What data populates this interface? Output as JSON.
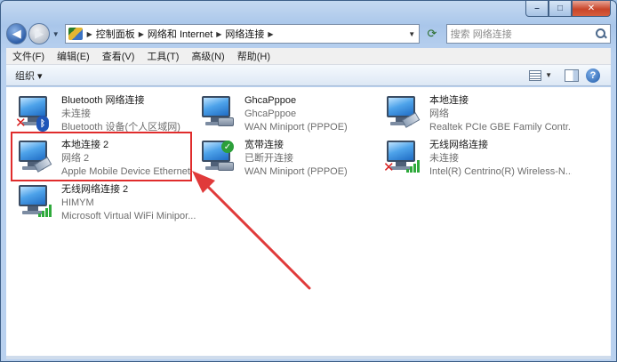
{
  "window": {
    "buttons": {
      "minimize": "–",
      "maximize": "□",
      "close": "✕"
    }
  },
  "nav": {
    "back_icon": "arrow-left-icon",
    "forward_icon": "arrow-right-icon",
    "breadcrumb": [
      "控制面板",
      "网络和 Internet",
      "网络连接"
    ],
    "search_placeholder": "搜索 网络连接"
  },
  "menu": [
    "文件(F)",
    "编辑(E)",
    "查看(V)",
    "工具(T)",
    "高级(N)",
    "帮助(H)"
  ],
  "command_bar": {
    "organize": "组织 ▾"
  },
  "connections": [
    {
      "name": "Bluetooth 网络连接",
      "status": "未连接",
      "device": "Bluetooth 设备(个人区域网)",
      "badge": "bluetooth-disconnected"
    },
    {
      "name": "GhcaPppoe",
      "status": "GhcaPppoe",
      "device": "WAN Miniport (PPPOE)",
      "badge": "modem"
    },
    {
      "name": "本地连接",
      "status": "网络",
      "device": "Realtek PCIe GBE Family Contr...",
      "badge": "cable"
    },
    {
      "name": "本地连接 2",
      "status": "网络  2",
      "device": "Apple Mobile Device Ethernet",
      "badge": "cable"
    },
    {
      "name": "宽带连接",
      "status": "已断开连接",
      "device": "WAN Miniport (PPPOE)",
      "badge": "modem-check"
    },
    {
      "name": "无线网络连接",
      "status": "未连接",
      "device": "Intel(R) Centrino(R) Wireless-N...",
      "badge": "wifi-disconnected"
    },
    {
      "name": "无线网络连接 2",
      "status": "HIMYM",
      "device": "Microsoft Virtual WiFi Minipor...",
      "badge": "wifi"
    }
  ],
  "colors": {
    "highlight": "#e02c2c",
    "arrow": "#e03a3a"
  }
}
